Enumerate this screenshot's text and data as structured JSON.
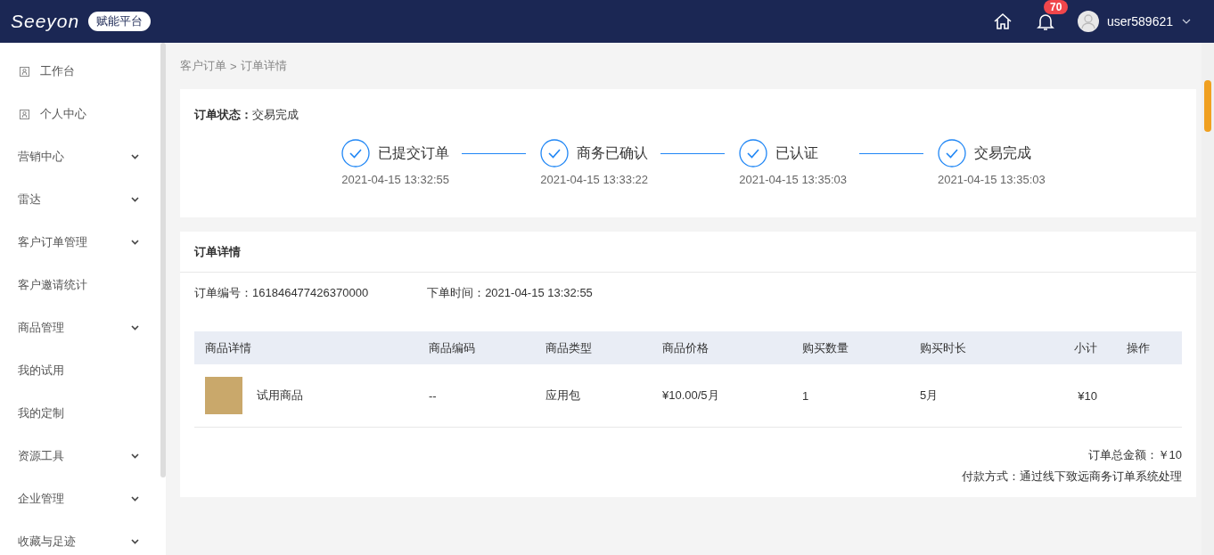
{
  "header": {
    "logo": "Seeyon",
    "badge": "赋能平台",
    "notifications": "70",
    "user": "user589621"
  },
  "sidebar": {
    "items": [
      {
        "label": "工作台",
        "kind": "icon",
        "expandable": false
      },
      {
        "label": "个人中心",
        "kind": "icon",
        "expandable": false
      },
      {
        "label": "营销中心",
        "kind": "plain",
        "expandable": true
      },
      {
        "label": "雷达",
        "kind": "plain",
        "expandable": true
      },
      {
        "label": "客户订单管理",
        "kind": "plain",
        "expandable": true
      },
      {
        "label": "客户邀请统计",
        "kind": "plain",
        "expandable": false
      },
      {
        "label": "商品管理",
        "kind": "plain",
        "expandable": true
      },
      {
        "label": "我的试用",
        "kind": "plain",
        "expandable": false
      },
      {
        "label": "我的定制",
        "kind": "plain",
        "expandable": false
      },
      {
        "label": "资源工具",
        "kind": "plain",
        "expandable": true
      },
      {
        "label": "企业管理",
        "kind": "plain",
        "expandable": true
      },
      {
        "label": "收藏与足迹",
        "kind": "plain",
        "expandable": true
      }
    ]
  },
  "breadcrumb": {
    "parent": "客户订单",
    "separator": ">",
    "current": "订单详情"
  },
  "status": {
    "label": "订单状态：",
    "value": "交易完成",
    "steps": [
      {
        "title": "已提交订单",
        "time": "2021-04-15 13:32:55",
        "done": true
      },
      {
        "title": "商务已确认",
        "time": "2021-04-15 13:33:22",
        "done": true
      },
      {
        "title": "已认证",
        "time": "2021-04-15 13:35:03",
        "done": true
      },
      {
        "title": "交易完成",
        "time": "2021-04-15 13:35:03",
        "done": true
      }
    ]
  },
  "details": {
    "title": "订单详情",
    "order_no": "订单编号：161846477426370000",
    "order_time": "下单时间：2021-04-15 13:32:55",
    "table": {
      "columns": [
        "商品详情",
        "商品编码",
        "商品类型",
        "商品价格",
        "购买数量",
        "购买时长",
        "小计",
        "操作"
      ],
      "rows": [
        {
          "name": "试用商品",
          "code": "--",
          "type": "应用包",
          "price": "¥10.00/5月",
          "quantity": "1",
          "duration": "5月",
          "subtotal": "¥10"
        }
      ]
    },
    "total": "订单总金额：￥10",
    "payment": "付款方式：通过线下致远商务订单系统处理"
  }
}
